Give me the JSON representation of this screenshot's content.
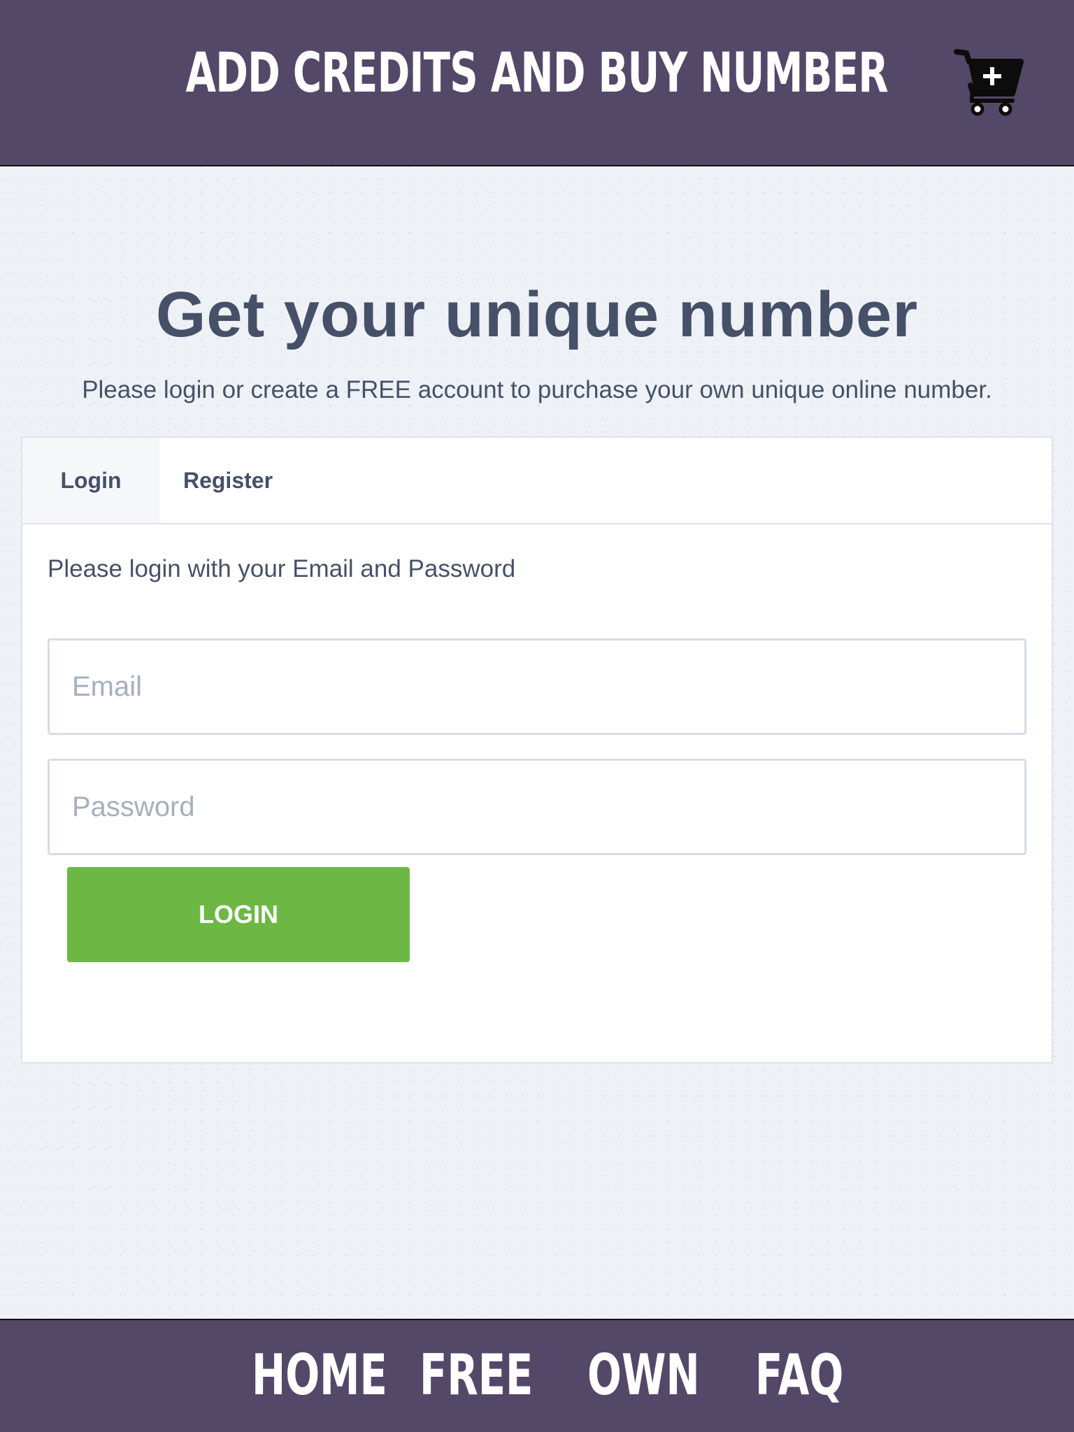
{
  "header": {
    "title": "ADD CREDITS AND BUY NUMBER",
    "cart_icon": "cart-plus-icon"
  },
  "hero": {
    "title": "Get your unique number",
    "subtitle": "Please login or create a FREE account to purchase your own unique online number."
  },
  "auth_panel": {
    "tabs": [
      {
        "label": "Login",
        "active": true
      },
      {
        "label": "Register",
        "active": false
      }
    ],
    "hint": "Please login with your Email and Password",
    "email": {
      "placeholder": "Email",
      "value": ""
    },
    "password": {
      "placeholder": "Password",
      "value": ""
    },
    "submit_label": "LOGIN"
  },
  "footer": {
    "nav": [
      {
        "label": "HOME"
      },
      {
        "label": "FREE"
      },
      {
        "label": "OWN"
      },
      {
        "label": "FAQ"
      }
    ]
  },
  "colors": {
    "header_bg": "#544869",
    "heading_text": "#465068",
    "login_button": "#6db844",
    "page_bg": "#eef2f6"
  }
}
